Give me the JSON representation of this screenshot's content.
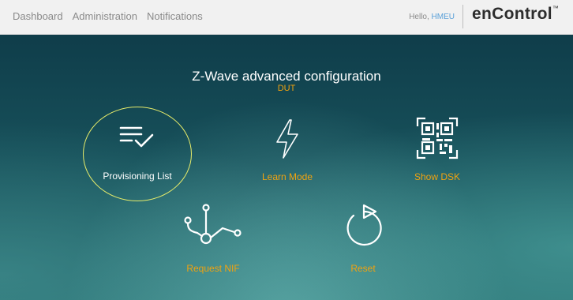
{
  "nav": {
    "items": [
      "Dashboard",
      "Administration",
      "Notifications"
    ]
  },
  "header": {
    "greeting": "Hello, ",
    "username": "HMEU",
    "brand": "enControl",
    "brand_mark": "™"
  },
  "page": {
    "title": "Z-Wave advanced configuration",
    "subtitle": "DUT"
  },
  "tiles": [
    {
      "label": "Provisioning List",
      "icon": "checklist-icon",
      "selected": true
    },
    {
      "label": "Learn Mode",
      "icon": "lightning-icon",
      "selected": false
    },
    {
      "label": "Show DSK",
      "icon": "qr-code-icon",
      "selected": false
    },
    {
      "label": "Request NIF",
      "icon": "network-nodes-icon",
      "selected": false
    },
    {
      "label": "Reset",
      "icon": "reset-icon",
      "selected": false
    }
  ],
  "colors": {
    "accent": "#f0a20f",
    "selected_label": "#ffffff",
    "selection_ring": "#e7ec6a",
    "link": "#5aa0d8"
  }
}
